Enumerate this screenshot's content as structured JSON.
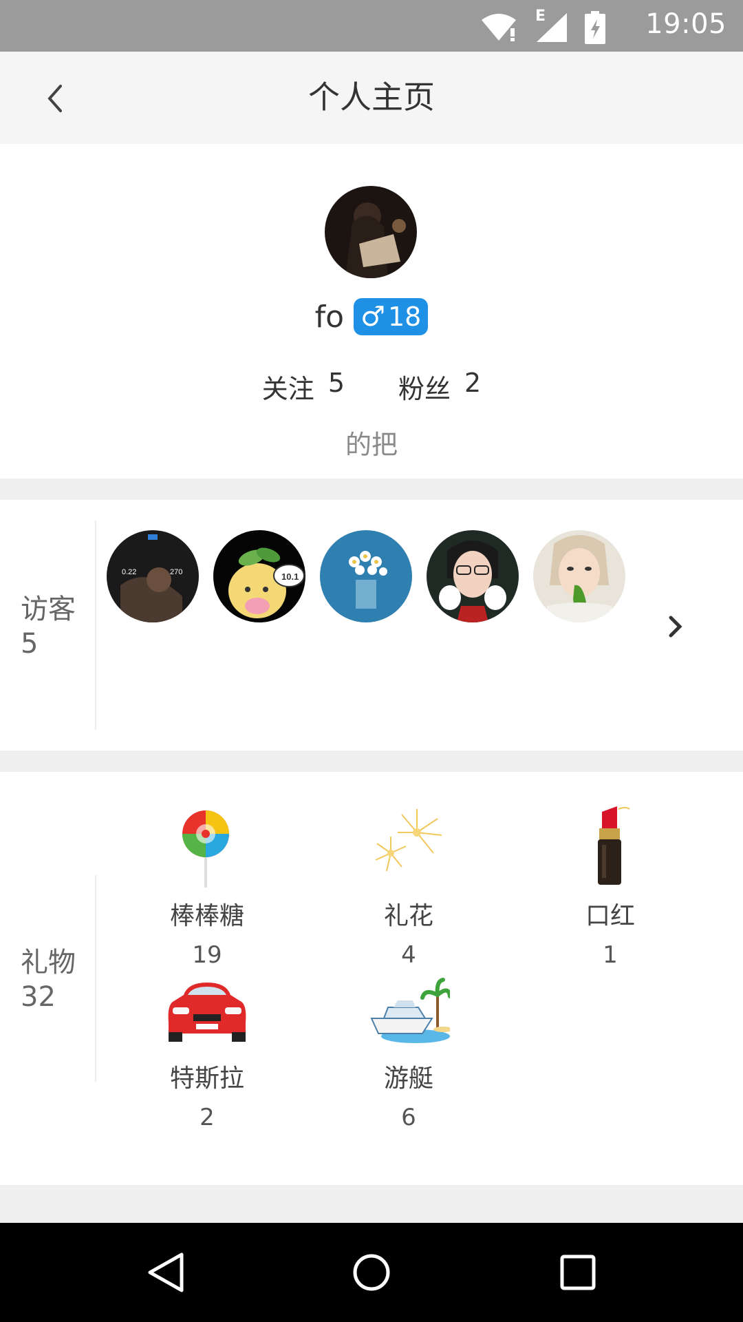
{
  "status_bar": {
    "time": "19:05",
    "network_type": "E"
  },
  "header": {
    "title": "个人主页",
    "back_icon": "chevron-left-icon"
  },
  "profile": {
    "username": "fo",
    "gender_symbol": "♂",
    "age": "18",
    "following_label": "关注",
    "following_count": "5",
    "followers_label": "粉丝",
    "followers_count": "2",
    "signature": "的把",
    "badge_color": "#1e90e6"
  },
  "visitors": {
    "label": "访客",
    "count": "5",
    "first_avatar_text": {
      "left_value": "0.22",
      "right_value": "270"
    },
    "third_avatar_badge": "10.1"
  },
  "gifts": {
    "label": "礼物",
    "total": "32",
    "items": [
      {
        "name": "棒棒糖",
        "count": "19",
        "icon": "lollipop-icon"
      },
      {
        "name": "礼花",
        "count": "4",
        "icon": "fireworks-icon"
      },
      {
        "name": "口红",
        "count": "1",
        "icon": "lipstick-icon"
      },
      {
        "name": "特斯拉",
        "count": "2",
        "icon": "car-icon"
      },
      {
        "name": "游艇",
        "count": "6",
        "icon": "yacht-icon"
      }
    ]
  },
  "nav_bar": {
    "back_icon": "triangle-back-icon",
    "home_icon": "circle-home-icon",
    "recents_icon": "square-recents-icon"
  }
}
